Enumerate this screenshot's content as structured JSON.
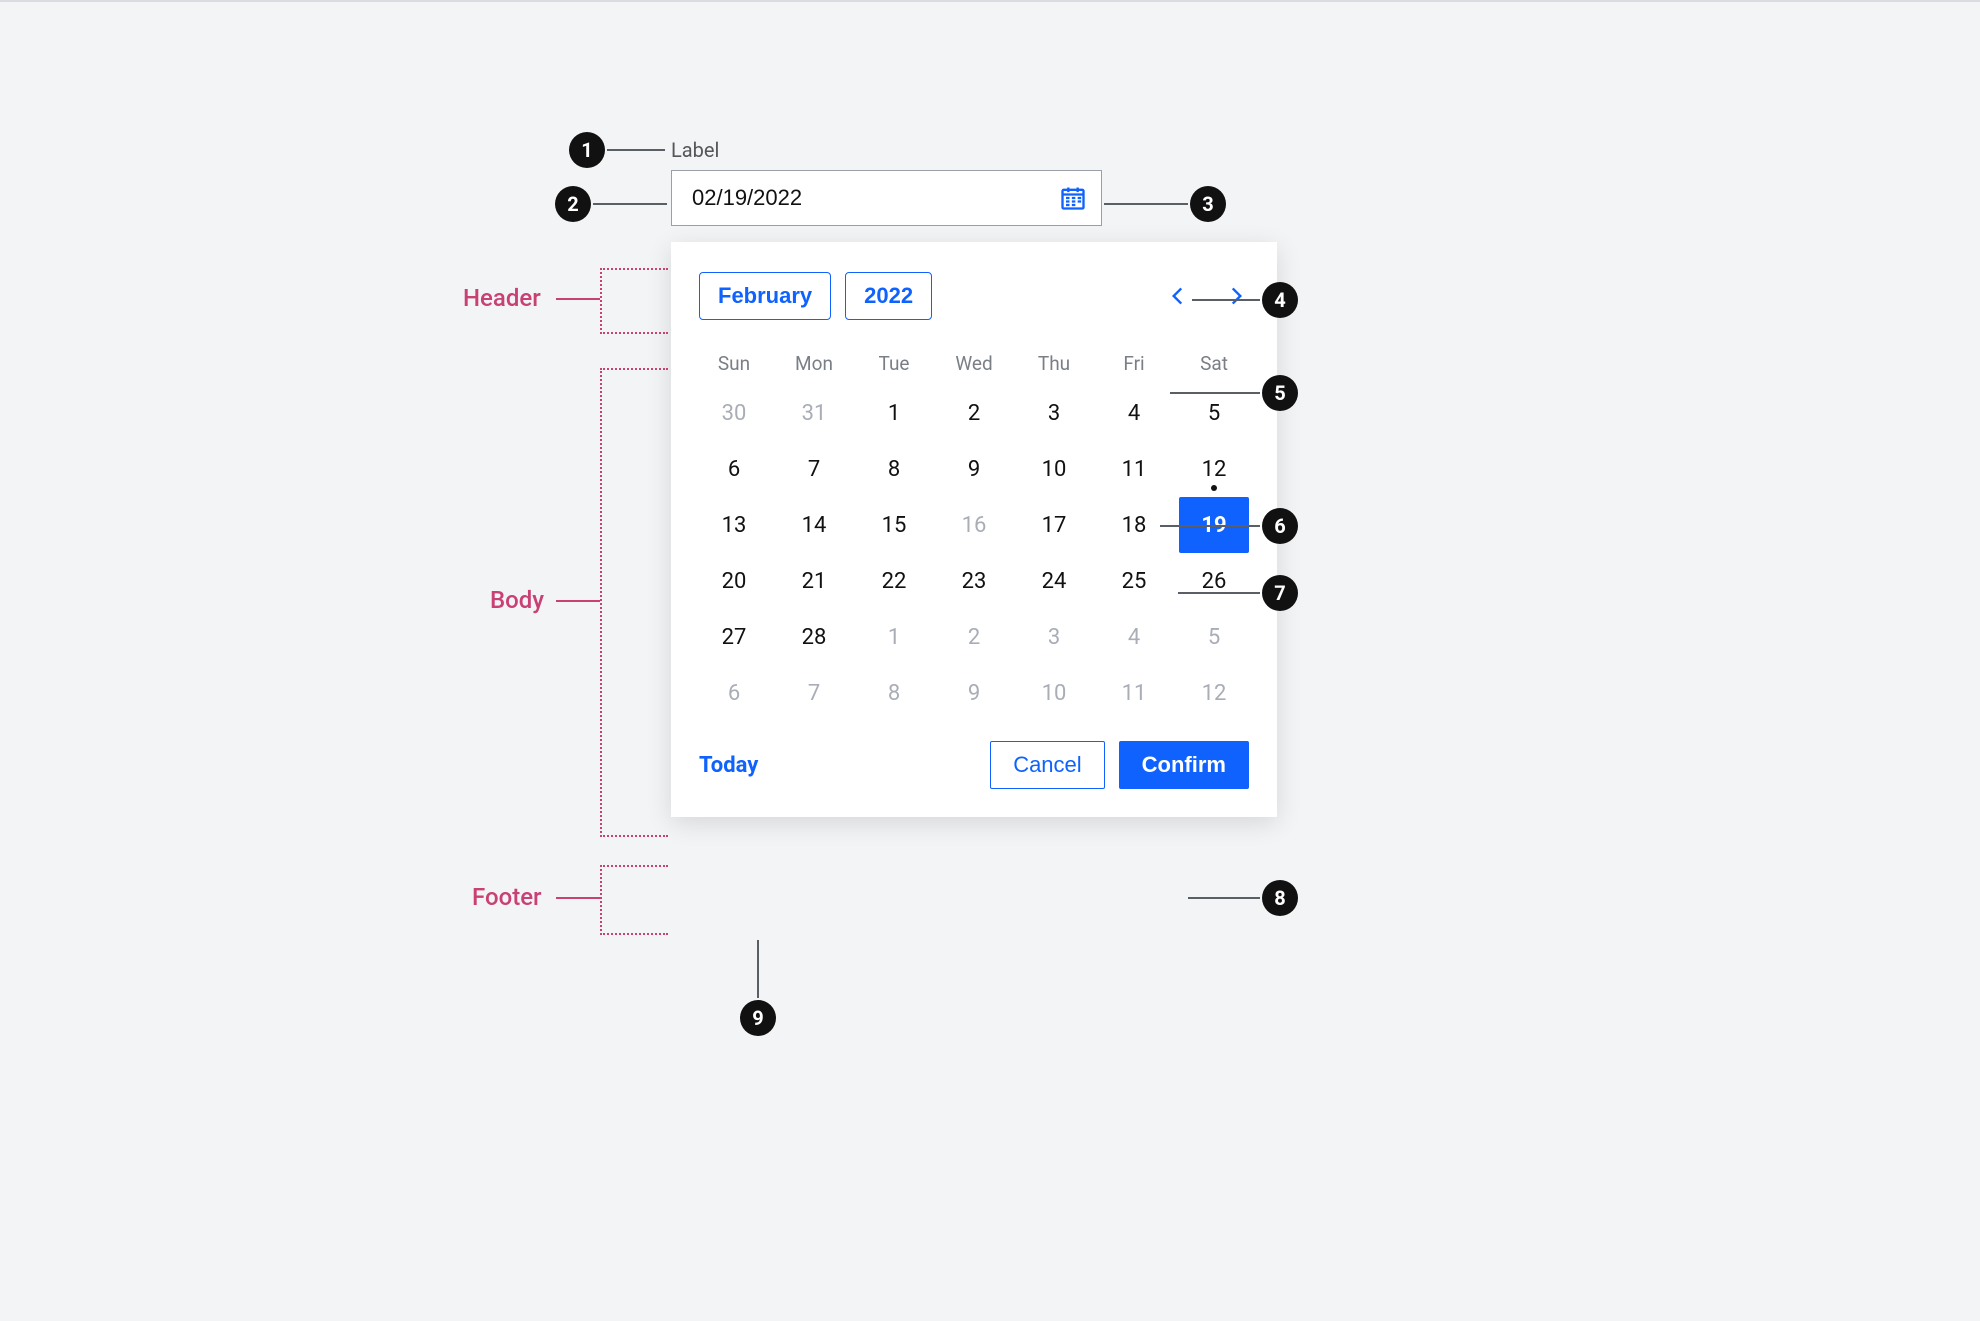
{
  "field": {
    "label": "Label",
    "value": "02/19/2022"
  },
  "header": {
    "month": "February",
    "year": "2022"
  },
  "weekdays": [
    "Sun",
    "Mon",
    "Tue",
    "Wed",
    "Thu",
    "Fri",
    "Sat"
  ],
  "weeks": [
    [
      {
        "n": 30,
        "state": "out"
      },
      {
        "n": 31,
        "state": "out"
      },
      {
        "n": 1,
        "state": "in"
      },
      {
        "n": 2,
        "state": "in"
      },
      {
        "n": 3,
        "state": "in"
      },
      {
        "n": 4,
        "state": "in"
      },
      {
        "n": 5,
        "state": "in"
      }
    ],
    [
      {
        "n": 6,
        "state": "in"
      },
      {
        "n": 7,
        "state": "in"
      },
      {
        "n": 8,
        "state": "in"
      },
      {
        "n": 9,
        "state": "in"
      },
      {
        "n": 10,
        "state": "in"
      },
      {
        "n": 11,
        "state": "in"
      },
      {
        "n": 12,
        "state": "in",
        "today": true
      }
    ],
    [
      {
        "n": 13,
        "state": "in"
      },
      {
        "n": 14,
        "state": "in"
      },
      {
        "n": 15,
        "state": "in"
      },
      {
        "n": 16,
        "state": "dis"
      },
      {
        "n": 17,
        "state": "in"
      },
      {
        "n": 18,
        "state": "in"
      },
      {
        "n": 19,
        "state": "in",
        "selected": true
      }
    ],
    [
      {
        "n": 20,
        "state": "in"
      },
      {
        "n": 21,
        "state": "in"
      },
      {
        "n": 22,
        "state": "in"
      },
      {
        "n": 23,
        "state": "in"
      },
      {
        "n": 24,
        "state": "in"
      },
      {
        "n": 25,
        "state": "in"
      },
      {
        "n": 26,
        "state": "in"
      }
    ],
    [
      {
        "n": 27,
        "state": "in"
      },
      {
        "n": 28,
        "state": "in"
      },
      {
        "n": 1,
        "state": "out"
      },
      {
        "n": 2,
        "state": "out"
      },
      {
        "n": 3,
        "state": "out"
      },
      {
        "n": 4,
        "state": "out"
      },
      {
        "n": 5,
        "state": "out"
      }
    ],
    [
      {
        "n": 6,
        "state": "out"
      },
      {
        "n": 7,
        "state": "out"
      },
      {
        "n": 8,
        "state": "out"
      },
      {
        "n": 9,
        "state": "out"
      },
      {
        "n": 10,
        "state": "out"
      },
      {
        "n": 11,
        "state": "out"
      },
      {
        "n": 12,
        "state": "out"
      }
    ]
  ],
  "footer": {
    "today": "Today",
    "cancel": "Cancel",
    "confirm": "Confirm"
  },
  "sections": {
    "header": "Header",
    "body": "Body",
    "footer": "Footer"
  },
  "callouts": {
    "1": "1",
    "2": "2",
    "3": "3",
    "4": "4",
    "5": "5",
    "6": "6",
    "7": "7",
    "8": "8",
    "9": "9"
  }
}
